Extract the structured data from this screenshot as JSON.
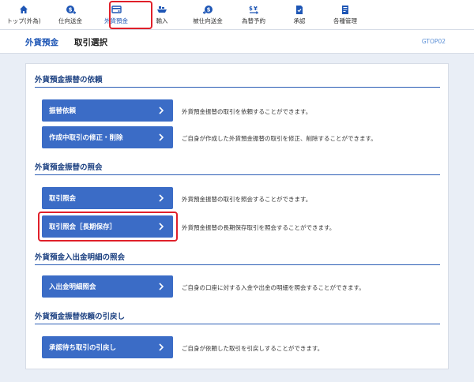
{
  "nav": {
    "items": [
      {
        "label": "トップ(外為)",
        "icon": "home-icon"
      },
      {
        "label": "仕向送金",
        "icon": "money-send-icon"
      },
      {
        "label": "外貨預金",
        "icon": "card-icon"
      },
      {
        "label": "輸入",
        "icon": "ship-icon"
      },
      {
        "label": "被仕向送金",
        "icon": "money-receive-icon"
      },
      {
        "label": "為替予約",
        "icon": "exchange-icon"
      },
      {
        "label": "承認",
        "icon": "approve-icon"
      },
      {
        "label": "各種管理",
        "icon": "admin-icon"
      }
    ],
    "active_index": 2
  },
  "header": {
    "title": "外貨預金",
    "subtitle": "取引選択",
    "screen_code": "GTOP02"
  },
  "sections": [
    {
      "heading": "外貨預金振替の依頼",
      "rows": [
        {
          "button": "振替依頼",
          "desc": "外貨預金振替の取引を依頼することができます。"
        },
        {
          "button": "作成中取引の修正・削除",
          "desc": "ご自身が作成した外貨預金振替の取引を修正、削除することができます。"
        }
      ]
    },
    {
      "heading": "外貨預金振替の照会",
      "rows": [
        {
          "button": "取引照会",
          "desc": "外貨預金振替の取引を照会することができます。"
        },
        {
          "button": "取引照会［長期保存］",
          "desc": "外貨預金振替の長期保存取引を照会することができます。"
        }
      ]
    },
    {
      "heading": "外貨預金入出金明細の照会",
      "rows": [
        {
          "button": "入出金明細照会",
          "desc": "ご自身の口座に対する入金や出金の明細を照会することができます。"
        }
      ]
    },
    {
      "heading": "外貨預金振替依頼の引戻し",
      "rows": [
        {
          "button": "承認待ち取引の引戻し",
          "desc": "ご自身が依頼した取引を引戻しすることができます。"
        }
      ]
    }
  ],
  "colors": {
    "accent": "#1e56b5",
    "button": "#3b6cc6",
    "highlight": "#e0202a",
    "background": "#e9eef6"
  }
}
